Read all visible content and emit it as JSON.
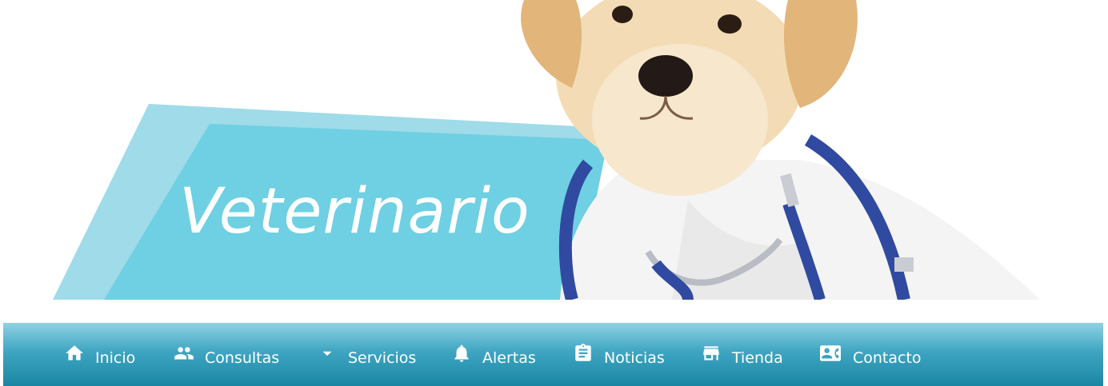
{
  "banner": {
    "title": "Veterinario",
    "image": "puppy-with-stethoscope"
  },
  "colors": {
    "banner_shape_light": "#9fdbe8",
    "banner_shape": "#6ed0e2",
    "nav_top": "#8fd2e3",
    "nav_bottom": "#1a86a4",
    "nav_text": "#ffffff"
  },
  "nav": {
    "items": [
      {
        "label": "Inicio",
        "icon": "home-icon"
      },
      {
        "label": "Consultas",
        "icon": "people-icon"
      },
      {
        "label": "Servicios",
        "icon": "caret-down-icon"
      },
      {
        "label": "Alertas",
        "icon": "bell-icon"
      },
      {
        "label": "Noticias",
        "icon": "clipboard-icon"
      },
      {
        "label": "Tienda",
        "icon": "store-icon"
      },
      {
        "label": "Contacto",
        "icon": "contact-card-icon"
      }
    ]
  }
}
